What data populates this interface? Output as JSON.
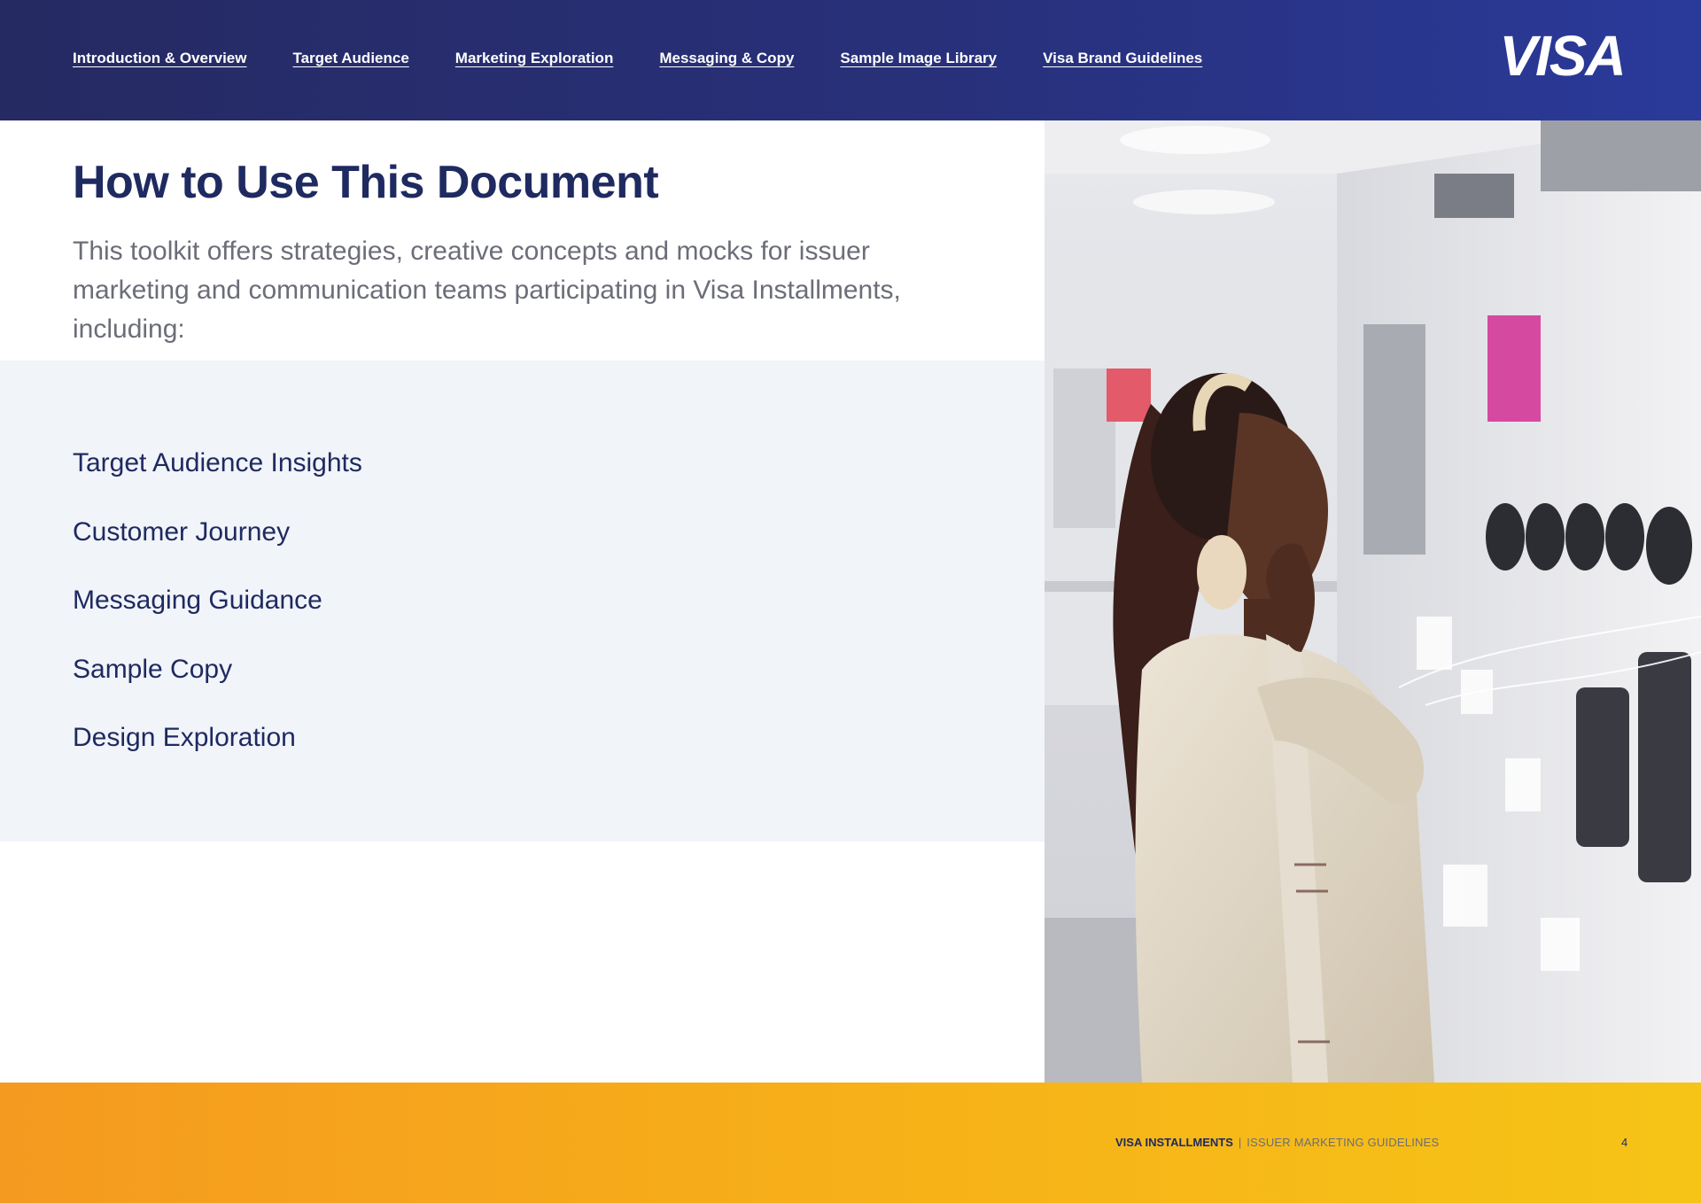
{
  "nav": {
    "items": [
      "Introduction & Overview",
      "Target Audience",
      "Marketing Exploration",
      "Messaging & Copy",
      "Sample Image Library",
      "Visa Brand Guidelines"
    ]
  },
  "brand": {
    "logo_text": "VISA"
  },
  "content": {
    "title": "How to Use This Document",
    "intro": "This toolkit offers strategies, creative concepts and mocks for issuer marketing and communication teams participating in Visa Installments, including:",
    "list": [
      "Target Audience Insights",
      "Customer Journey",
      "Messaging Guidance",
      "Sample Copy",
      "Design Exploration"
    ]
  },
  "footer": {
    "brand": "VISA INSTALLMENTS",
    "separator": "|",
    "subtitle": "ISSUER  MARKETING GUIDELINES",
    "page_number": "4"
  },
  "colors": {
    "header_navy": "#262a62",
    "title_navy": "#1e2a60",
    "band_gray": "#f1f4f9",
    "footer_orange": "#f59a20",
    "footer_yellow": "#f6c417"
  },
  "photo": {
    "icon": "photo-of-shopper"
  }
}
